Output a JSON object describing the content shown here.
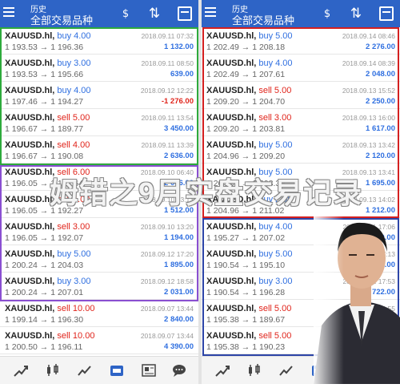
{
  "colors": {
    "header": "#2e64c6",
    "buy": "#2f6fe0",
    "sell": "#e0241b",
    "green_box": "#2eaa3c",
    "purple_box": "#8a4fd1",
    "red_box": "#d42020",
    "blue_box": "#2d45a8"
  },
  "left": {
    "header": {
      "title": "历史",
      "subtitle": "全部交易品种"
    },
    "trades": [
      {
        "symbol": "XAUUSD.hl,",
        "side": "buy",
        "lot": "buy 4.00",
        "prices": "1 193.53 → 1 196.36",
        "date": "2018.09.11 07:32",
        "profit": "1 132.00",
        "sign": "pos"
      },
      {
        "symbol": "XAUUSD.hl,",
        "side": "buy",
        "lot": "buy 3.00",
        "prices": "1 193.53 → 1 195.66",
        "date": "2018.09.11 08:50",
        "profit": "639.00",
        "sign": "pos"
      },
      {
        "symbol": "XAUUSD.hl,",
        "side": "buy",
        "lot": "buy 4.00",
        "prices": "1 197.46 → 1 194.27",
        "date": "2018.09.12 12:22",
        "profit": "-1 276.00",
        "sign": "neg"
      },
      {
        "symbol": "XAUUSD.hl,",
        "side": "sell",
        "lot": "sell 5.00",
        "prices": "1 196.67 → 1 189.77",
        "date": "2018.09.11 13:54",
        "profit": "3 450.00",
        "sign": "pos"
      },
      {
        "symbol": "XAUUSD.hl,",
        "side": "sell",
        "lot": "sell 4.00",
        "prices": "1 196.67 → 1 190.08",
        "date": "2018.09.11 13:39",
        "profit": "2 636.00",
        "sign": "pos"
      },
      {
        "symbol": "XAUUSD.hl,",
        "side": "sell",
        "lot": "sell 6.00",
        "prices": "1 196.05 → 1 192.64",
        "date": "2018.09.10 06:40",
        "profit": "2 046.00",
        "sign": "pos"
      },
      {
        "symbol": "XAUUSD.hl,",
        "side": "sell",
        "lot": "sell 4.00",
        "prices": "1 196.05 → 1 192.27",
        "date": "2018.09.10 13:13",
        "profit": "1 512.00",
        "sign": "pos"
      },
      {
        "symbol": "XAUUSD.hl,",
        "side": "sell",
        "lot": "sell 3.00",
        "prices": "1 196.05 → 1 192.07",
        "date": "2018.09.10 13:20",
        "profit": "1 194.00",
        "sign": "pos"
      },
      {
        "symbol": "XAUUSD.hl,",
        "side": "buy",
        "lot": "buy 5.00",
        "prices": "1 200.24 → 1 204.03",
        "date": "2018.09.12 17:20",
        "profit": "1 895.00",
        "sign": "pos"
      },
      {
        "symbol": "XAUUSD.hl,",
        "side": "buy",
        "lot": "buy 3.00",
        "prices": "1 200.24 → 1 207.01",
        "date": "2018.09.12 18:58",
        "profit": "2 031.00",
        "sign": "pos"
      },
      {
        "symbol": "XAUUSD.hl,",
        "side": "sell",
        "lot": "sell 10.00",
        "prices": "1 199.14 → 1 196.30",
        "date": "2018.09.07 13:44",
        "profit": "2 840.00",
        "sign": "pos"
      },
      {
        "symbol": "XAUUSD.hl,",
        "side": "sell",
        "lot": "sell 10.00",
        "prices": "1 200.50 → 1 196.11",
        "date": "2018.09.07 13:44",
        "profit": "4 390.00",
        "sign": "pos"
      }
    ]
  },
  "right": {
    "header": {
      "title": "历史",
      "subtitle": "全部交易品种"
    },
    "trades": [
      {
        "symbol": "XAUUSD.hl,",
        "side": "buy",
        "lot": "buy 5.00",
        "prices": "1 202.49 → 1 208.18",
        "date": "2018.09.14 08:46",
        "profit": "2 276.00",
        "sign": "pos"
      },
      {
        "symbol": "XAUUSD.hl,",
        "side": "buy",
        "lot": "buy 4.00",
        "prices": "1 202.49 → 1 207.61",
        "date": "2018.09.14 08:39",
        "profit": "2 048.00",
        "sign": "pos"
      },
      {
        "symbol": "XAUUSD.hl,",
        "side": "sell",
        "lot": "sell 5.00",
        "prices": "1 209.20 → 1 204.70",
        "date": "2018.09.13 15:52",
        "profit": "2 250.00",
        "sign": "pos"
      },
      {
        "symbol": "XAUUSD.hl,",
        "side": "sell",
        "lot": "sell 3.00",
        "prices": "1 209.20 → 1 203.81",
        "date": "2018.09.13 16:00",
        "profit": "1 617.00",
        "sign": "pos"
      },
      {
        "symbol": "XAUUSD.hl,",
        "side": "buy",
        "lot": "buy 5.00",
        "prices": "1 204.96 → 1 209.20",
        "date": "2018.09.13 13:42",
        "profit": "2 120.00",
        "sign": "pos"
      },
      {
        "symbol": "XAUUSD.hl,",
        "side": "buy",
        "lot": "buy 5.00",
        "prices": "1 204.96 → 1 208.35",
        "date": "2018.09.13 13:41",
        "profit": "1 695.00",
        "sign": "pos"
      },
      {
        "symbol": "XAUUSD.hl,",
        "side": "buy",
        "lot": "buy 2.00",
        "prices": "1 204.96 → 1 211.02",
        "date": "2018.09.13 14:02",
        "profit": "1 212.00",
        "sign": "pos"
      },
      {
        "symbol": "XAUUSD.hl,",
        "side": "buy",
        "lot": "buy 4.00",
        "prices": "1 195.27 → 1 207.02",
        "date": "2018.09.11 17:06",
        "profit": "4 700.00",
        "sign": "pos"
      },
      {
        "symbol": "XAUUSD.hl,",
        "side": "buy",
        "lot": "buy 5.00",
        "prices": "1 190.54 → 1 195.10",
        "date": "2018.09.11 17:13",
        "profit": "2 280.00",
        "sign": "pos"
      },
      {
        "symbol": "XAUUSD.hl,",
        "side": "buy",
        "lot": "buy 3.00",
        "prices": "1 190.54 → 1 196.28",
        "date": "2018.09.11 17:53",
        "profit": "1 722.00",
        "sign": "pos"
      },
      {
        "symbol": "XAUUSD.hl,",
        "side": "sell",
        "lot": "sell 5.00",
        "prices": "1 195.38 → 1 189.67",
        "date": "2018.09.11 13:55",
        "profit": "2 855.00",
        "sign": "pos"
      },
      {
        "symbol": "XAUUSD.hl,",
        "side": "sell",
        "lot": "sell 5.00",
        "prices": "1 195.38 → 1 190.23",
        "date": "2018.09.11 13:38",
        "profit": "2 575.00",
        "sign": "pos"
      }
    ]
  },
  "overlay": {
    "banner": "姆错之9月实盘交易记录"
  },
  "nav_icons": [
    "quotes-icon",
    "chart-icon",
    "trade-icon",
    "history-icon",
    "news-icon",
    "chat-icon"
  ]
}
